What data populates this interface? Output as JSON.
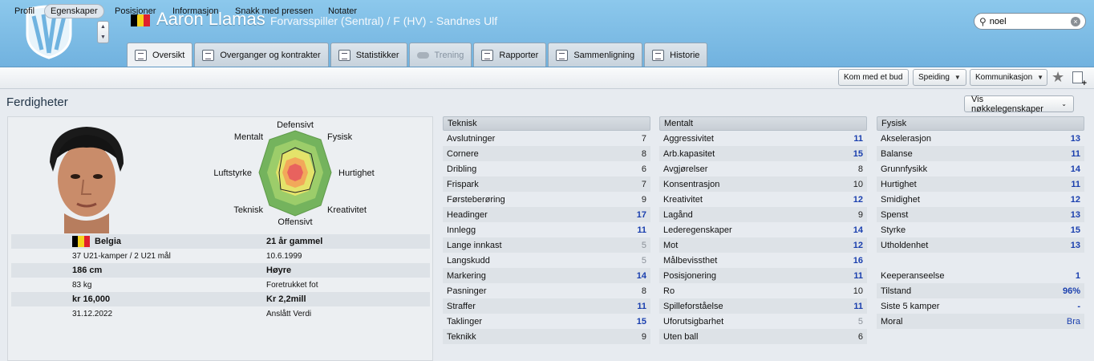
{
  "header": {
    "player_name": "Aaron Llamas",
    "subtitle": "Forvarsspiller (Sentral) / F (HV) - Sandnes Ulf",
    "search_value": "noel"
  },
  "tabs": [
    {
      "label": "Oversikt",
      "active": true
    },
    {
      "label": "Overganger og kontrakter"
    },
    {
      "label": "Statistikker"
    },
    {
      "label": "Trening",
      "disabled": true
    },
    {
      "label": "Rapporter"
    },
    {
      "label": "Sammenligning"
    },
    {
      "label": "Historie"
    }
  ],
  "subnav": [
    "Profil",
    "Egenskaper",
    "Posisjoner",
    "Informasjon",
    "Snakk med pressen",
    "Notater"
  ],
  "actions": {
    "bid": "Kom med et bud",
    "scout": "Speiding",
    "comm": "Kommunikasjon"
  },
  "section_title": "Ferdigheter",
  "key_attrs_button": "Vis nøkkelegenskaper",
  "radar": {
    "top": "Defensivt",
    "top_right": "Fysisk",
    "right": "Hurtighet",
    "bottom_right": "Kreativitet",
    "bottom": "Offensivt",
    "bottom_left": "Teknisk",
    "left": "Luftstyrke",
    "top_left": "Mentalt"
  },
  "info": {
    "nation": "Belgia",
    "age": "21 år gammel",
    "caps": "37 U21-kamper / 2 U21 mål",
    "dob": "10.6.1999",
    "height": "186 cm",
    "foot": "Høyre",
    "weight": "83 kg",
    "foot_label": "Foretrukket fot",
    "wage": "kr 16,000",
    "value": "Kr 2,2mill",
    "contract_end": "31.12.2022",
    "value_label": "Anslått Verdi"
  },
  "colors": {
    "belgium": [
      "#000000",
      "#f5d21c",
      "#e0202c"
    ],
    "blue_value": "#1a3fae",
    "grey_value": "#8a9098"
  },
  "teknisk": {
    "title": "Teknisk",
    "rows": [
      {
        "name": "Avslutninger",
        "value": "7"
      },
      {
        "name": "Cornere",
        "value": "8"
      },
      {
        "name": "Dribling",
        "value": "6"
      },
      {
        "name": "Frispark",
        "value": "7"
      },
      {
        "name": "Førsteberøring",
        "value": "9"
      },
      {
        "name": "Headinger",
        "value": "17",
        "style": "blue"
      },
      {
        "name": "Innlegg",
        "value": "11",
        "style": "blue"
      },
      {
        "name": "Lange innkast",
        "value": "5",
        "style": "grey"
      },
      {
        "name": "Langskudd",
        "value": "5",
        "style": "grey"
      },
      {
        "name": "Markering",
        "value": "14",
        "style": "blue"
      },
      {
        "name": "Pasninger",
        "value": "8"
      },
      {
        "name": "Straffer",
        "value": "11",
        "style": "blue"
      },
      {
        "name": "Taklinger",
        "value": "15",
        "style": "blue"
      },
      {
        "name": "Teknikk",
        "value": "9"
      }
    ]
  },
  "mentalt": {
    "title": "Mentalt",
    "rows": [
      {
        "name": "Aggressivitet",
        "value": "11",
        "style": "blue"
      },
      {
        "name": "Arb.kapasitet",
        "value": "15",
        "style": "blue"
      },
      {
        "name": "Avgjørelser",
        "value": "8"
      },
      {
        "name": "Konsentrasjon",
        "value": "10"
      },
      {
        "name": "Kreativitet",
        "value": "12",
        "style": "blue"
      },
      {
        "name": "Lagånd",
        "value": "9"
      },
      {
        "name": "Lederegenskaper",
        "value": "14",
        "style": "blue"
      },
      {
        "name": "Mot",
        "value": "12",
        "style": "blue"
      },
      {
        "name": "Målbevissthet",
        "value": "16",
        "style": "blue"
      },
      {
        "name": "Posisjonering",
        "value": "11",
        "style": "blue"
      },
      {
        "name": "Ro",
        "value": "10"
      },
      {
        "name": "Spilleforståelse",
        "value": "11",
        "style": "blue"
      },
      {
        "name": "Uforutsigbarhet",
        "value": "5",
        "style": "grey"
      },
      {
        "name": "Uten ball",
        "value": "6"
      }
    ]
  },
  "fysisk": {
    "title": "Fysisk",
    "rows": [
      {
        "name": "Akselerasjon",
        "value": "13",
        "style": "blue"
      },
      {
        "name": "Balanse",
        "value": "11",
        "style": "blue"
      },
      {
        "name": "Grunnfysikk",
        "value": "14",
        "style": "blue"
      },
      {
        "name": "Hurtighet",
        "value": "11",
        "style": "blue"
      },
      {
        "name": "Smidighet",
        "value": "12",
        "style": "blue"
      },
      {
        "name": "Spenst",
        "value": "13",
        "style": "blue"
      },
      {
        "name": "Styrke",
        "value": "15",
        "style": "blue"
      },
      {
        "name": "Utholdenhet",
        "value": "13",
        "style": "blue"
      }
    ]
  },
  "extra": {
    "rows": [
      {
        "name": "Keeperanseelse",
        "value": "1",
        "style": "blue"
      },
      {
        "name": "Tilstand",
        "value": "96%",
        "style": "blue"
      },
      {
        "name": "Siste 5 kamper",
        "value": "-",
        "style": "blue"
      },
      {
        "name": "Moral",
        "value": "Bra",
        "style": "blue-normal"
      }
    ]
  }
}
